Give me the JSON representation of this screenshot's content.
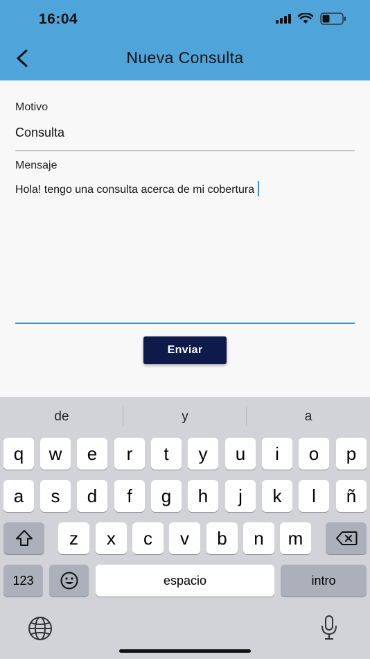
{
  "status": {
    "time": "16:04"
  },
  "header": {
    "title": "Nueva Consulta"
  },
  "form": {
    "motivo_label": "Motivo",
    "motivo_value": "Consulta",
    "mensaje_label": "Mensaje",
    "mensaje_value": "Hola! tengo una consulta acerca de mi cobertura",
    "send_label": "Enviar"
  },
  "keyboard": {
    "suggestions": [
      "de",
      "y",
      "a"
    ],
    "row1": [
      "q",
      "w",
      "e",
      "r",
      "t",
      "y",
      "u",
      "i",
      "o",
      "p"
    ],
    "row2": [
      "a",
      "s",
      "d",
      "f",
      "g",
      "h",
      "j",
      "k",
      "l",
      "ñ"
    ],
    "row3": [
      "z",
      "x",
      "c",
      "v",
      "b",
      "n",
      "m"
    ],
    "numbers_label": "123",
    "space_label": "espacio",
    "return_label": "intro"
  },
  "colors": {
    "header": "#4fa5da",
    "button": "#0e1a4a",
    "accent": "#3a8fdc"
  }
}
